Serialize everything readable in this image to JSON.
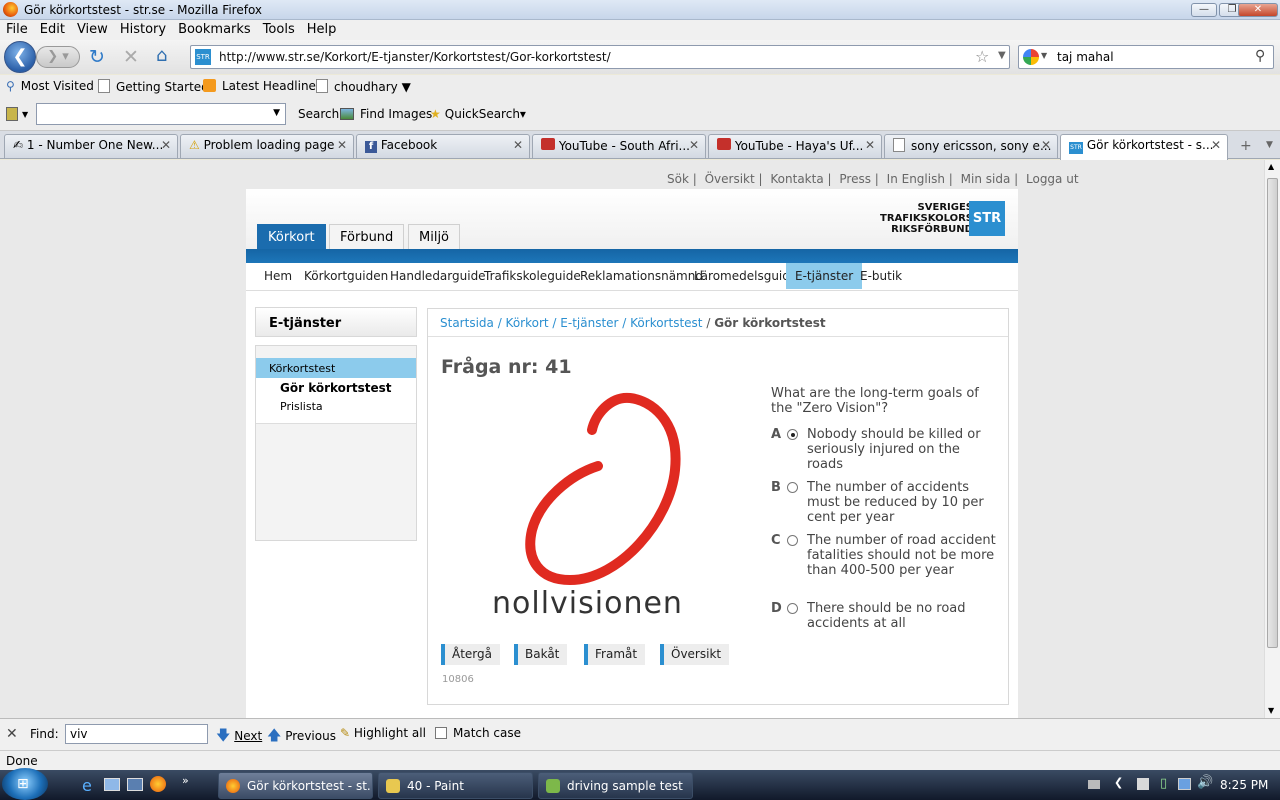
{
  "window": {
    "title": "Gör körkortstest - str.se - Mozilla Firefox"
  },
  "menu": [
    "File",
    "Edit",
    "View",
    "History",
    "Bookmarks",
    "Tools",
    "Help"
  ],
  "nav": {
    "url": "http://www.str.se/Korkort/E-tjanster/Korkortstest/Gor-korkortstest/",
    "search_value": "taj mahal"
  },
  "bookmarks": [
    "Most Visited",
    "Getting Started",
    "Latest Headlines",
    "choudhary ▼"
  ],
  "toolbar": {
    "search": "Search",
    "find_images": "Find Images",
    "quicksearch": "QuickSearch▾"
  },
  "tabs": [
    {
      "label": "1 - Number One New..."
    },
    {
      "label": "Problem loading page"
    },
    {
      "label": "Facebook"
    },
    {
      "label": "YouTube - South Afri..."
    },
    {
      "label": "YouTube - Haya's Uf..."
    },
    {
      "label": "sony ericsson, sony e..."
    },
    {
      "label": "Gör körkortstest - s..."
    }
  ],
  "site": {
    "top_links": [
      "Sök |",
      "Översikt |",
      "Kontakta |",
      "Press |",
      "In English |",
      "Min sida |",
      "Logga ut"
    ],
    "main_tabs": [
      "Körkort",
      "Förbund",
      "Miljö"
    ],
    "sub_nav": [
      "Hem",
      "Körkortguiden",
      "Handledarguide",
      "Trafikskoleguide",
      "Reklamationsnämnd",
      "Läromedelsguide",
      "E-tjänster",
      "E-butik"
    ],
    "logo_lines": [
      "SVERIGES",
      "TRAFIKSKOLORS",
      "RIKSFÖRBUND"
    ],
    "logo_box": "STR",
    "sidebar": {
      "title": "E-tjänster",
      "selected": "Körkortstest",
      "sub_active": "Gör körkortstest",
      "sub_other": "Prislista"
    },
    "breadcrumb": [
      "Startsida",
      "Körkort",
      "E-tjänster",
      "Körkortstest",
      "Gör körkortstest"
    ],
    "question_title": "Fråga nr: 41",
    "question": "What are the long-term goals of the \"Zero Vision\"?",
    "image_caption": "nollvisionen",
    "answers": [
      {
        "letter": "A",
        "text": "Nobody should be killed or seriously injured on the roads",
        "selected": true
      },
      {
        "letter": "B",
        "text": "The number of accidents must be reduced by 10 per cent per year",
        "selected": false
      },
      {
        "letter": "C",
        "text": "The number of road accident fatalities should not be more than 400-500 per year",
        "selected": false
      },
      {
        "letter": "D",
        "text": "There should be no road accidents at all",
        "selected": false
      }
    ],
    "buttons": [
      "Återgå",
      "Bakåt",
      "Framåt",
      "Översikt"
    ],
    "code": "10806"
  },
  "findbar": {
    "label": "Find:",
    "value": "viv",
    "next": "Next",
    "previous": "Previous",
    "highlight": "Highlight all",
    "match_case": "Match case"
  },
  "status": "Done",
  "taskbar": {
    "items": [
      "Gör körkortstest - st...",
      "40 - Paint",
      "driving sample test"
    ],
    "clock": "8:25 PM"
  },
  "colors": {
    "accent": "#2b8fd0",
    "logo_red": "#e02a20",
    "nav_blue": "#1b6cae"
  }
}
